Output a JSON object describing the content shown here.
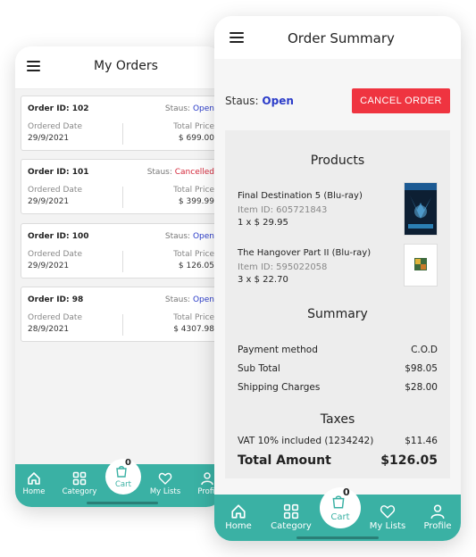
{
  "my_orders": {
    "title": "My Orders",
    "orders": [
      {
        "id_label": "Order ID: 102",
        "status_label": "Staus:",
        "status": "Open",
        "date_label": "Ordered Date",
        "date": "29/9/2021",
        "price_label": "Total Price",
        "price": "$ 699.00"
      },
      {
        "id_label": "Order ID: 101",
        "status_label": "Staus:",
        "status": "Cancelled",
        "date_label": "Ordered Date",
        "date": "29/9/2021",
        "price_label": "Total Price",
        "price": "$ 399.99"
      },
      {
        "id_label": "Order ID: 100",
        "status_label": "Staus:",
        "status": "Open",
        "date_label": "Ordered Date",
        "date": "29/9/2021",
        "price_label": "Total Price",
        "price": "$ 126.05"
      },
      {
        "id_label": "Order ID: 98",
        "status_label": "Staus:",
        "status": "Open",
        "date_label": "Ordered Date",
        "date": "28/9/2021",
        "price_label": "Total Price",
        "price": "$ 4307.98"
      }
    ]
  },
  "order_summary": {
    "title": "Order Summary",
    "status_label": "Staus:",
    "status": "Open",
    "cancel_label": "CANCEL ORDER",
    "products_title": "Products",
    "products": [
      {
        "name": "Final Destination 5 (Blu-ray)",
        "item_id": "Item ID: 605721843",
        "qty": "1 x $ 29.95"
      },
      {
        "name": "The Hangover Part II (Blu-ray)",
        "item_id": "Item ID: 595022058",
        "qty": "3 x $ 22.70"
      }
    ],
    "summary_title": "Summary",
    "payment_label": "Payment method",
    "payment_value": "C.O.D",
    "subtotal_label": "Sub Total",
    "subtotal_value": "$98.05",
    "shipping_label": "Shipping Charges",
    "shipping_value": "$28.00",
    "taxes_title": "Taxes",
    "vat_label": "VAT 10% included (1234242)",
    "vat_value": "$11.46",
    "total_label": "Total Amount",
    "total_value": "$126.05"
  },
  "nav": {
    "home": "Home",
    "category": "Category",
    "cart": "Cart",
    "cart_count": "0",
    "lists": "My Lists",
    "profile": "Profile",
    "profile_truncated": "Profil"
  },
  "colors": {
    "teal": "#3ab1a4",
    "open_blue": "#2b3cc9",
    "cancel_red": "#ef3440"
  },
  "icons": [
    "menu-icon",
    "home-icon",
    "category-icon",
    "cart-icon",
    "heart-icon",
    "profile-icon"
  ]
}
